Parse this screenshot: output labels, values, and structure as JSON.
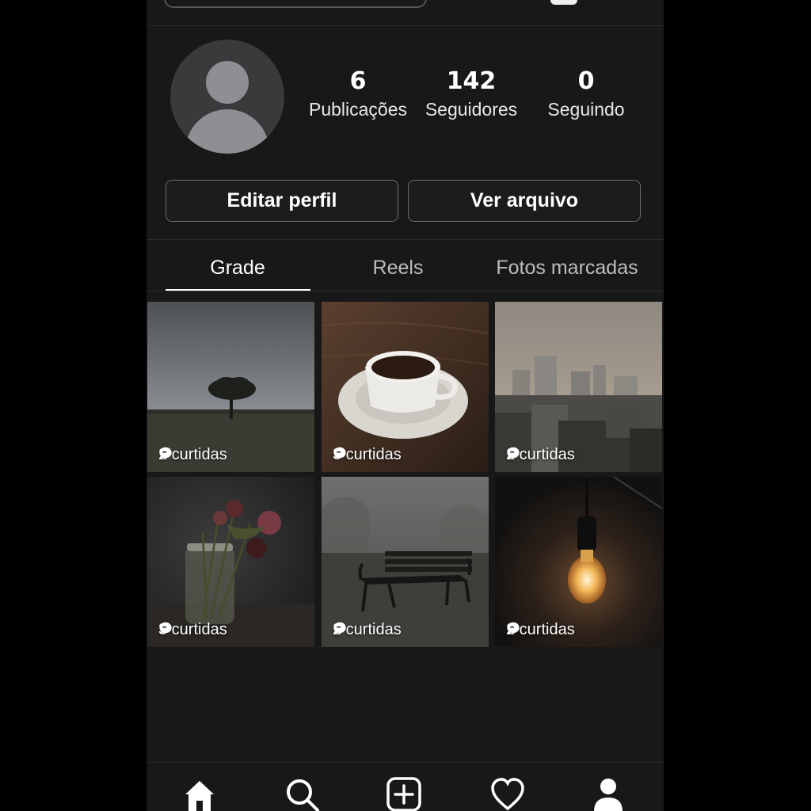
{
  "profile": {
    "stats": [
      {
        "value": "6",
        "label": "Publicações"
      },
      {
        "value": "142",
        "label": "Seguidores"
      },
      {
        "value": "0",
        "label": "Seguindo"
      }
    ]
  },
  "buttons": {
    "edit_profile": "Editar perfil",
    "view_archive": "Ver arquivo"
  },
  "tabs": [
    {
      "label": "Grade",
      "active": true
    },
    {
      "label": "Reels",
      "active": false
    },
    {
      "label": "Fotos marcadas",
      "active": false
    }
  ],
  "posts": [
    {
      "subject": "lone tree under overcast sky",
      "likes": "2 curtidas"
    },
    {
      "subject": "coffee cup on saucer",
      "likes": "3 curtidas"
    },
    {
      "subject": "hazy city skyline",
      "likes": "2 curtidas"
    },
    {
      "subject": "dried roses in jar",
      "likes": "3 curtidas"
    },
    {
      "subject": "park bench in fog",
      "likes": "2 curtidas"
    },
    {
      "subject": "hanging light bulb",
      "likes": "2 curtidas"
    }
  ],
  "navbar": {
    "icons": [
      "home-icon",
      "search-icon",
      "add-post-icon",
      "heart-icon",
      "profile-icon"
    ]
  },
  "colors": {
    "background": "#181818",
    "outer": "#000000",
    "text": "#ffffff",
    "muted_text": "#bdbdbd",
    "button_border": "#6b6b6b"
  }
}
